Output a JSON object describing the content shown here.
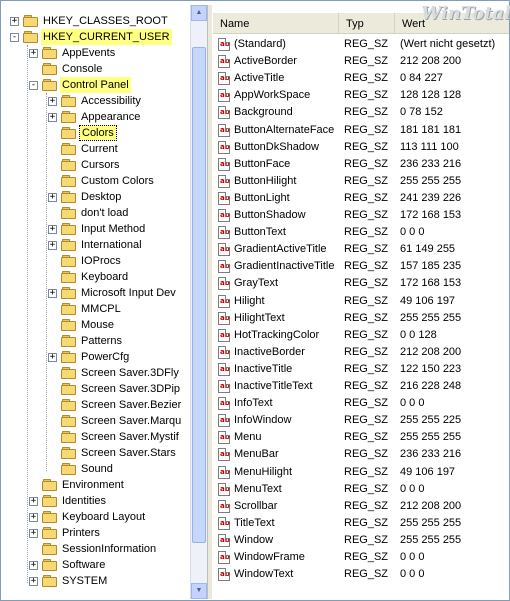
{
  "watermark": "WinTotal",
  "tree": [
    {
      "label": "HKEY_CLASSES_ROOT",
      "level": 0,
      "expander": "+",
      "state": ""
    },
    {
      "label": "HKEY_CURRENT_USER",
      "level": 0,
      "expander": "-",
      "state": "sel"
    },
    {
      "label": "AppEvents",
      "level": 1,
      "expander": "+",
      "state": ""
    },
    {
      "label": "Console",
      "level": 1,
      "expander": "",
      "state": ""
    },
    {
      "label": "Control Panel",
      "level": 1,
      "expander": "-",
      "state": "sel"
    },
    {
      "label": "Accessibility",
      "level": 2,
      "expander": "+",
      "state": ""
    },
    {
      "label": "Appearance",
      "level": 2,
      "expander": "+",
      "state": ""
    },
    {
      "label": "Colors",
      "level": 2,
      "expander": "",
      "state": "cur"
    },
    {
      "label": "Current",
      "level": 2,
      "expander": "",
      "state": ""
    },
    {
      "label": "Cursors",
      "level": 2,
      "expander": "",
      "state": ""
    },
    {
      "label": "Custom Colors",
      "level": 2,
      "expander": "",
      "state": ""
    },
    {
      "label": "Desktop",
      "level": 2,
      "expander": "+",
      "state": ""
    },
    {
      "label": "don't load",
      "level": 2,
      "expander": "",
      "state": ""
    },
    {
      "label": "Input Method",
      "level": 2,
      "expander": "+",
      "state": ""
    },
    {
      "label": "International",
      "level": 2,
      "expander": "+",
      "state": ""
    },
    {
      "label": "IOProcs",
      "level": 2,
      "expander": "",
      "state": ""
    },
    {
      "label": "Keyboard",
      "level": 2,
      "expander": "",
      "state": ""
    },
    {
      "label": "Microsoft Input Dev",
      "level": 2,
      "expander": "+",
      "state": ""
    },
    {
      "label": "MMCPL",
      "level": 2,
      "expander": "",
      "state": ""
    },
    {
      "label": "Mouse",
      "level": 2,
      "expander": "",
      "state": ""
    },
    {
      "label": "Patterns",
      "level": 2,
      "expander": "",
      "state": ""
    },
    {
      "label": "PowerCfg",
      "level": 2,
      "expander": "+",
      "state": ""
    },
    {
      "label": "Screen Saver.3DFly",
      "level": 2,
      "expander": "",
      "state": ""
    },
    {
      "label": "Screen Saver.3DPip",
      "level": 2,
      "expander": "",
      "state": ""
    },
    {
      "label": "Screen Saver.Bezier",
      "level": 2,
      "expander": "",
      "state": ""
    },
    {
      "label": "Screen Saver.Marqu",
      "level": 2,
      "expander": "",
      "state": ""
    },
    {
      "label": "Screen Saver.Mystif",
      "level": 2,
      "expander": "",
      "state": ""
    },
    {
      "label": "Screen Saver.Stars",
      "level": 2,
      "expander": "",
      "state": ""
    },
    {
      "label": "Sound",
      "level": 2,
      "expander": "",
      "state": ""
    },
    {
      "label": "Environment",
      "level": 1,
      "expander": "",
      "state": ""
    },
    {
      "label": "Identities",
      "level": 1,
      "expander": "+",
      "state": ""
    },
    {
      "label": "Keyboard Layout",
      "level": 1,
      "expander": "+",
      "state": ""
    },
    {
      "label": "Printers",
      "level": 1,
      "expander": "+",
      "state": ""
    },
    {
      "label": "SessionInformation",
      "level": 1,
      "expander": "",
      "state": ""
    },
    {
      "label": "Software",
      "level": 1,
      "expander": "+",
      "state": ""
    },
    {
      "label": "SYSTEM",
      "level": 1,
      "expander": "+",
      "state": ""
    }
  ],
  "columns": {
    "name": "Name",
    "type": "Typ",
    "data": "Wert"
  },
  "values": [
    {
      "name": "(Standard)",
      "type": "REG_SZ",
      "data": "(Wert nicht gesetzt)"
    },
    {
      "name": "ActiveBorder",
      "type": "REG_SZ",
      "data": "212 208 200"
    },
    {
      "name": "ActiveTitle",
      "type": "REG_SZ",
      "data": "0 84 227"
    },
    {
      "name": "AppWorkSpace",
      "type": "REG_SZ",
      "data": "128 128 128"
    },
    {
      "name": "Background",
      "type": "REG_SZ",
      "data": "0 78 152"
    },
    {
      "name": "ButtonAlternateFace",
      "type": "REG_SZ",
      "data": "181 181 181"
    },
    {
      "name": "ButtonDkShadow",
      "type": "REG_SZ",
      "data": "113 111 100"
    },
    {
      "name": "ButtonFace",
      "type": "REG_SZ",
      "data": "236 233 216"
    },
    {
      "name": "ButtonHilight",
      "type": "REG_SZ",
      "data": "255 255 255"
    },
    {
      "name": "ButtonLight",
      "type": "REG_SZ",
      "data": "241 239 226"
    },
    {
      "name": "ButtonShadow",
      "type": "REG_SZ",
      "data": "172 168 153"
    },
    {
      "name": "ButtonText",
      "type": "REG_SZ",
      "data": "0 0 0"
    },
    {
      "name": "GradientActiveTitle",
      "type": "REG_SZ",
      "data": "61 149 255"
    },
    {
      "name": "GradientInactiveTitle",
      "type": "REG_SZ",
      "data": "157 185 235"
    },
    {
      "name": "GrayText",
      "type": "REG_SZ",
      "data": "172 168 153"
    },
    {
      "name": "Hilight",
      "type": "REG_SZ",
      "data": "49 106 197"
    },
    {
      "name": "HilightText",
      "type": "REG_SZ",
      "data": "255 255 255"
    },
    {
      "name": "HotTrackingColor",
      "type": "REG_SZ",
      "data": "0 0 128"
    },
    {
      "name": "InactiveBorder",
      "type": "REG_SZ",
      "data": "212 208 200"
    },
    {
      "name": "InactiveTitle",
      "type": "REG_SZ",
      "data": "122 150 223"
    },
    {
      "name": "InactiveTitleText",
      "type": "REG_SZ",
      "data": "216 228 248"
    },
    {
      "name": "InfoText",
      "type": "REG_SZ",
      "data": "0 0 0"
    },
    {
      "name": "InfoWindow",
      "type": "REG_SZ",
      "data": "255 255 225"
    },
    {
      "name": "Menu",
      "type": "REG_SZ",
      "data": "255 255 255"
    },
    {
      "name": "MenuBar",
      "type": "REG_SZ",
      "data": "236 233 216"
    },
    {
      "name": "MenuHilight",
      "type": "REG_SZ",
      "data": "49 106 197"
    },
    {
      "name": "MenuText",
      "type": "REG_SZ",
      "data": "0 0 0"
    },
    {
      "name": "Scrollbar",
      "type": "REG_SZ",
      "data": "212 208 200"
    },
    {
      "name": "TitleText",
      "type": "REG_SZ",
      "data": "255 255 255"
    },
    {
      "name": "Window",
      "type": "REG_SZ",
      "data": "255 255 255"
    },
    {
      "name": "WindowFrame",
      "type": "REG_SZ",
      "data": "0 0 0"
    },
    {
      "name": "WindowText",
      "type": "REG_SZ",
      "data": "0 0 0"
    }
  ],
  "colors": {
    "selection": "#ffff80",
    "folder": "#f7d874",
    "header": "#ebeadb",
    "icon_text": "#c00000"
  },
  "icons": {
    "folder": "folder-icon",
    "value": "string-value-icon",
    "expander": "tree-expander-icon"
  }
}
